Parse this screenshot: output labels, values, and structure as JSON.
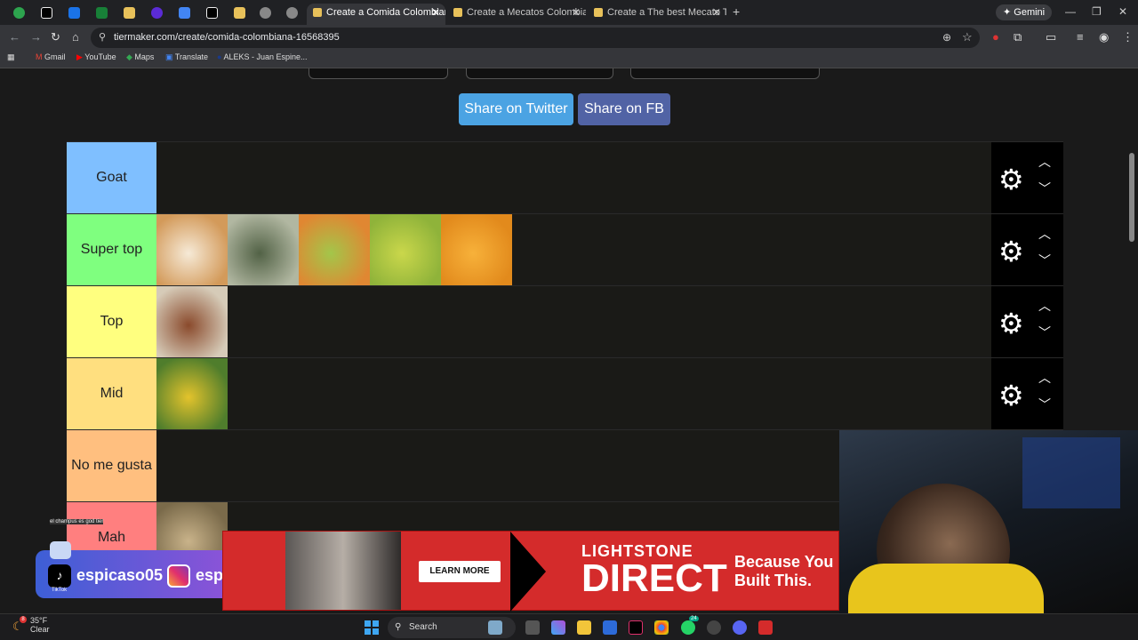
{
  "browser": {
    "pinned_tabs": [
      "pinned-tab-1",
      "pinned-tab-2",
      "pinned-tab-3",
      "pinned-tab-4",
      "pinned-tab-5",
      "pinned-tab-6",
      "pinned-tab-7",
      "pinned-tab-8",
      "pinned-tab-9",
      "pinned-tab-10",
      "pinned-tab-11"
    ],
    "tabs": [
      {
        "title": "Create a Comida Colombiana Ti"
      },
      {
        "title": "Create a Mecatos Colombianos"
      },
      {
        "title": "Create a The best Mecato Tier L"
      }
    ],
    "gemini_label": "Gemini",
    "url": "tiermaker.com/create/comida-colombiana-16568395",
    "bookmarks": [
      "Gmail",
      "YouTube",
      "Maps",
      "Translate",
      "ALEKS - Juan Espine..."
    ]
  },
  "share": {
    "twitter": "Share on Twitter",
    "fb": "Share on FB"
  },
  "tiers": [
    {
      "label": "Goat",
      "color": "#7fbfff",
      "items": []
    },
    {
      "label": "Super top",
      "color": "#7fff7f",
      "items": [
        {
          "icon": "arroz-con-leche",
          "c1": "#f6ead7",
          "c2": "#d39a5a"
        },
        {
          "icon": "sancocho",
          "c1": "#526246",
          "c2": "#b1b7a1"
        },
        {
          "icon": "limonada",
          "c1": "#a3c64a",
          "c2": "#e08732"
        },
        {
          "icon": "ajiaco",
          "c1": "#cad74b",
          "c2": "#8fb33a"
        },
        {
          "icon": "empanadas",
          "c1": "#f7b13a",
          "c2": "#e28a1c"
        }
      ]
    },
    {
      "label": "Top",
      "color": "#ffff7f",
      "items": [
        {
          "icon": "arepas",
          "c1": "#8a4a2c",
          "c2": "#d6cbb8"
        }
      ]
    },
    {
      "label": "Mid",
      "color": "#ffdf7f",
      "items": [
        {
          "icon": "arroz-con-pollo",
          "c1": "#e3c32c",
          "c2": "#4f7d2c"
        }
      ]
    },
    {
      "label": "No me gusta",
      "color": "#ffbf7f",
      "items": []
    },
    {
      "label": "Mah",
      "color": "#ff7f7f",
      "items": [
        {
          "icon": "partial-food",
          "c1": "#c9b38a",
          "c2": "#7a6a4a"
        }
      ]
    }
  ],
  "chat": "el champus es god tier",
  "social": {
    "tiktok": "espicaso05",
    "instagram": "espicaso05",
    "tiktok_caption": "TikTok"
  },
  "ad": {
    "learn_more": "LEARN MORE",
    "brand_line1": "LIGHTSTONE",
    "brand_line2": "DIRECT",
    "tagline": "Because You\nBuilt This."
  },
  "taskbar": {
    "temp": "35°F",
    "condition": "Clear",
    "search": "Search",
    "badge": "24"
  }
}
